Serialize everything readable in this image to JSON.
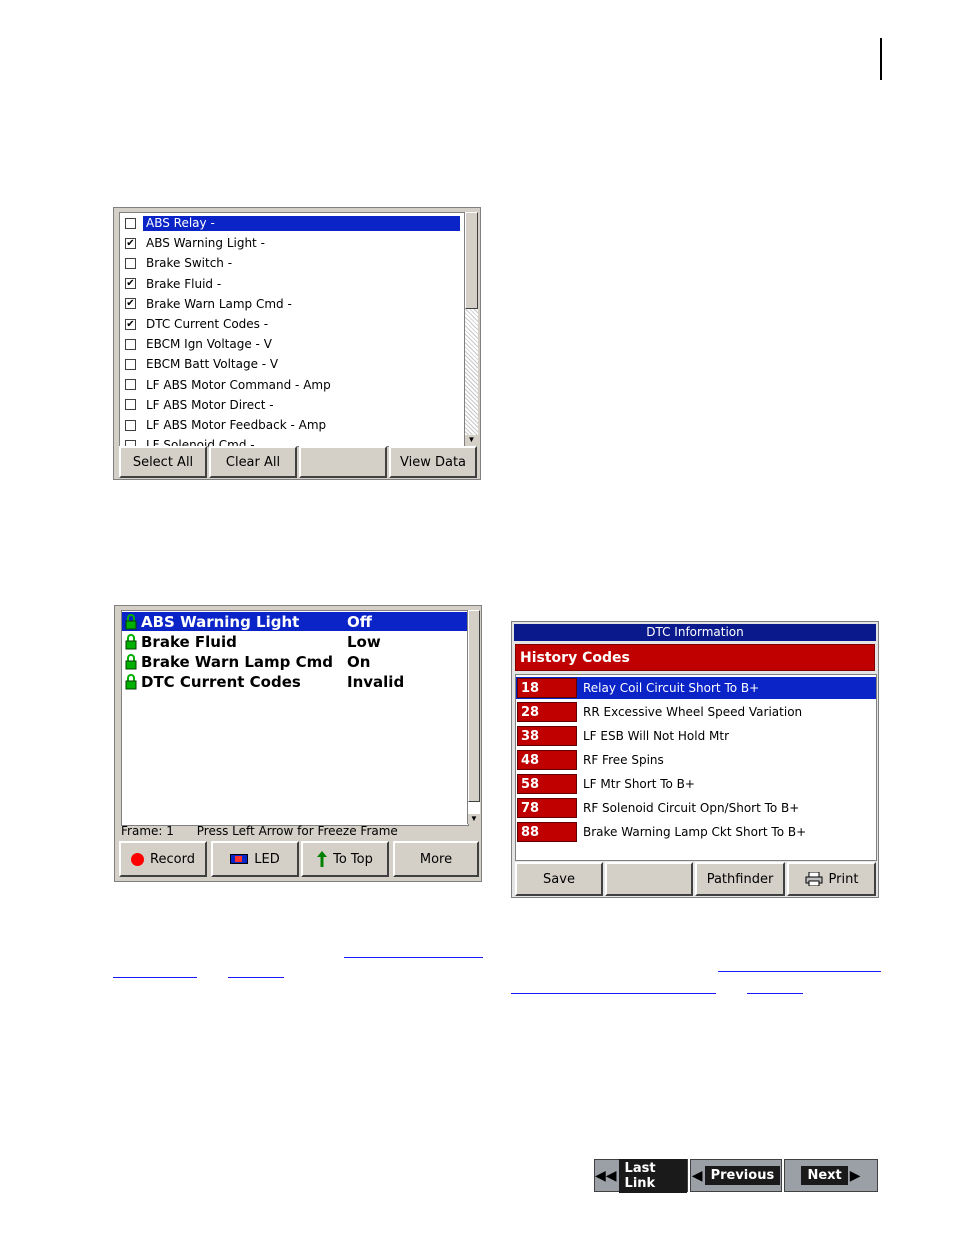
{
  "param_select": {
    "items": [
      {
        "label": "ABS Relay -",
        "checked": false,
        "selected": true
      },
      {
        "label": "ABS Warning Light -",
        "checked": true
      },
      {
        "label": "Brake Switch -",
        "checked": false
      },
      {
        "label": "Brake Fluid -",
        "checked": true
      },
      {
        "label": "Brake Warn Lamp Cmd -",
        "checked": true
      },
      {
        "label": "DTC Current Codes -",
        "checked": true
      },
      {
        "label": "EBCM Ign Voltage - V",
        "checked": false
      },
      {
        "label": "EBCM Batt Voltage - V",
        "checked": false
      },
      {
        "label": "LF ABS Motor Command - Amp",
        "checked": false
      },
      {
        "label": "LF ABS Motor Direct -",
        "checked": false
      },
      {
        "label": "LF ABS Motor Feedback - Amp",
        "checked": false
      },
      {
        "label": "LF Solenoid Cmd -",
        "checked": false
      }
    ],
    "buttons": {
      "select_all": "Select All",
      "clear_all": "Clear All",
      "blank": "",
      "view_data": "View Data"
    }
  },
  "data_display": {
    "rows": [
      {
        "name": "ABS Warning Light",
        "value": "Off",
        "selected": true
      },
      {
        "name": "Brake Fluid",
        "value": "Low"
      },
      {
        "name": "Brake Warn Lamp Cmd",
        "value": "On"
      },
      {
        "name": "DTC Current Codes",
        "value": "Invalid"
      }
    ],
    "frame_label": "Frame: 1",
    "frame_hint": "Press Left Arrow for Freeze Frame",
    "buttons": {
      "record": "Record",
      "led": "LED",
      "to_top": "To Top",
      "more": "More"
    }
  },
  "dtc_info": {
    "title": "DTC Information",
    "header": "History Codes",
    "codes": [
      {
        "code": "18",
        "desc": "Relay Coil Circuit Short To B+",
        "selected": true
      },
      {
        "code": "28",
        "desc": "RR Excessive Wheel Speed Variation"
      },
      {
        "code": "38",
        "desc": "LF ESB Will Not Hold Mtr"
      },
      {
        "code": "48",
        "desc": "RF Free Spins"
      },
      {
        "code": "58",
        "desc": "LF Mtr Short To B+"
      },
      {
        "code": "78",
        "desc": "RF Solenoid Circuit Opn/Short To B+"
      },
      {
        "code": "88",
        "desc": "Brake Warning Lamp Ckt Short To B+"
      }
    ],
    "buttons": {
      "save": "Save",
      "blank": "",
      "pathfinder": "Pathfinder",
      "print": "Print"
    }
  },
  "nav": {
    "last_link": "Last Link",
    "previous": "Previous",
    "next": "Next"
  },
  "colors": {
    "selection": "#0a24c8",
    "code_red": "#c00000",
    "title_navy": "#0a1a8c",
    "record_red": "#ff0000",
    "arrow_green": "#008000"
  }
}
